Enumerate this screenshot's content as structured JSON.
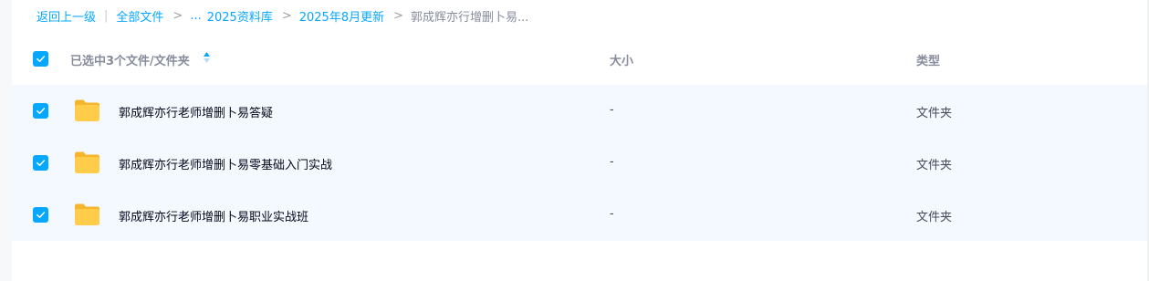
{
  "breadcrumb": {
    "back_label": "返回上一级",
    "divider": "|",
    "root_label": "全部文件",
    "ellipsis_label": "...",
    "crumbs": [
      "2025资料库",
      "2025年8月更新"
    ],
    "current_label": "郭成辉亦行增删卜易...",
    "arrow": ">"
  },
  "header": {
    "selection_label": "已选中3个文件/文件夹",
    "size_label": "大小",
    "type_label": "类型",
    "all_checked": true
  },
  "rows": [
    {
      "name": "郭成辉亦行老师增删卜易答疑",
      "size": "-",
      "type": "文件夹",
      "checked": true
    },
    {
      "name": "郭成辉亦行老师增删卜易零基础入门实战",
      "size": "-",
      "type": "文件夹",
      "checked": true
    },
    {
      "name": "郭成辉亦行老师增删卜易职业实战班",
      "size": "-",
      "type": "文件夹",
      "checked": true
    }
  ],
  "icons": {
    "checkbox": "check-icon",
    "folder": "folder-icon",
    "sort": "sort-icon"
  },
  "colors": {
    "accent": "#06a7ff",
    "row_selected_bg": "#f3f9fe",
    "folder": "#ffc43a",
    "header_text": "#878c9c",
    "body_text": "#03081a"
  }
}
